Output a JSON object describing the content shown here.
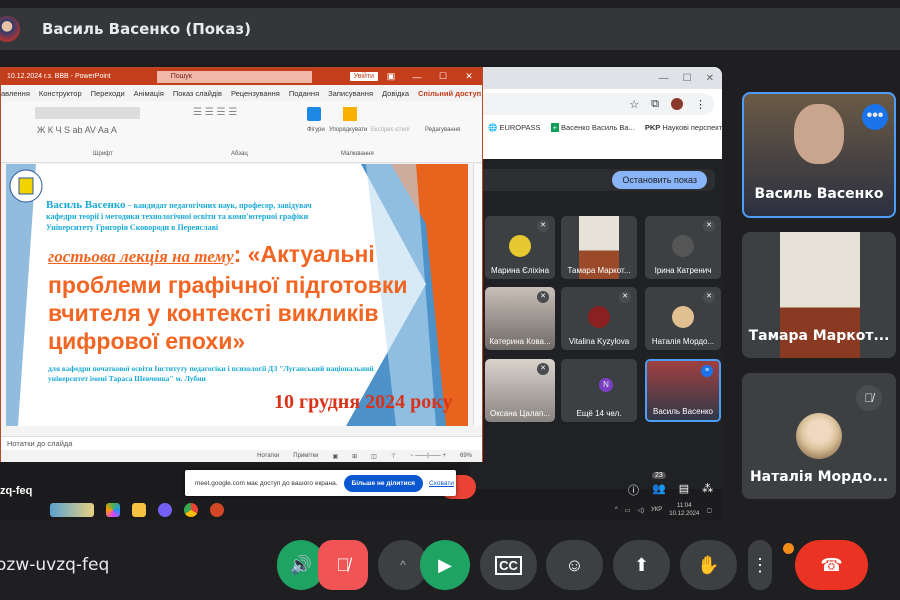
{
  "header": {
    "title": "Василь Васенко (Показ)"
  },
  "powerpoint": {
    "window_title": "10.12.2024 г.з. BBB - PowerPoint",
    "search_placeholder": "Пошук",
    "login": "Увійти",
    "menu": [
      "авлення",
      "Конструктор",
      "Переходи",
      "Анімація",
      "Показ слайдів",
      "Рецензування",
      "Подання",
      "Записування",
      "Довідка"
    ],
    "share": "Спільний доступ",
    "ribbon_groups": [
      "Шрифт",
      "Абзац",
      "Малювання",
      "Редагування"
    ],
    "ribbon_buttons": [
      "Фігури",
      "Упорядкувати",
      "Експрес-стилі"
    ],
    "slide": {
      "line1_name": "Василь Васенко",
      "line1": " – кандидат педагогічних наук, професор, завідувач",
      "line2": "кафедри теорії і методики технологічної освіти та комп'ютерної графіки",
      "line3": "Університету Григорія Сковороди в Переяславі",
      "lecture_label": "гостьова лекція на тему",
      "title": ": «Актуальні проблеми графічної підготовки вчителя у контексті викликів цифрової епохи»",
      "audience": "для кафедри початкової освіти Інституту педагогіки і психології ДЗ \"Луганський національний університет імені Тараса Шевченка\" м. Лубни",
      "date": "10 грудня 2024 року"
    },
    "notes": "Нотатки до слайда",
    "status": {
      "notes_btn": "Нотатки",
      "comments_btn": "Примітки",
      "zoom": "69%"
    }
  },
  "chrome": {
    "bookmarks": [
      "EUROPASS",
      "Васенко Василь Ва...",
      "Наукові перспекти..."
    ]
  },
  "inner_meet": {
    "stop_button": "Остановить показ",
    "tiles": [
      {
        "name": "Марина Єліхіна",
        "muted": true
      },
      {
        "name": "Тамара Маркот...",
        "muted": false
      },
      {
        "name": "Ірина Катренич",
        "muted": true
      },
      {
        "name": "Катерина Кова...",
        "muted": true
      },
      {
        "name": "Vitalina Kyzylova",
        "muted": true
      },
      {
        "name": "Наталія Мордо...",
        "muted": true
      },
      {
        "name": "Оксана Цалап...",
        "muted": true
      },
      {
        "name": "Ещё 14 чел.",
        "muted": false
      },
      {
        "name": "Василь Васенко",
        "muted": false
      }
    ],
    "participants_count": "23"
  },
  "share_notice": {
    "text": "meet.google.com має доступ до вашого екрана.",
    "stop": "Більше не ділитися",
    "hide": "Сховати"
  },
  "taskbar": {
    "lang": "УКР",
    "time": "11:04",
    "date": "10.12.2024"
  },
  "tiles": [
    {
      "name": "Василь Васенко"
    },
    {
      "name": "Тамара Маркот..."
    },
    {
      "name": "Наталія Мордо..."
    }
  ],
  "meeting_code": "ozw-uvzq-feq",
  "colors": {
    "bg": "#1f1f22",
    "green": "#1ea362",
    "red": "#ea4335",
    "accent": "#8ab4f8",
    "slide_orange": "#f26522",
    "slide_cyan": "#1aa9d6"
  }
}
